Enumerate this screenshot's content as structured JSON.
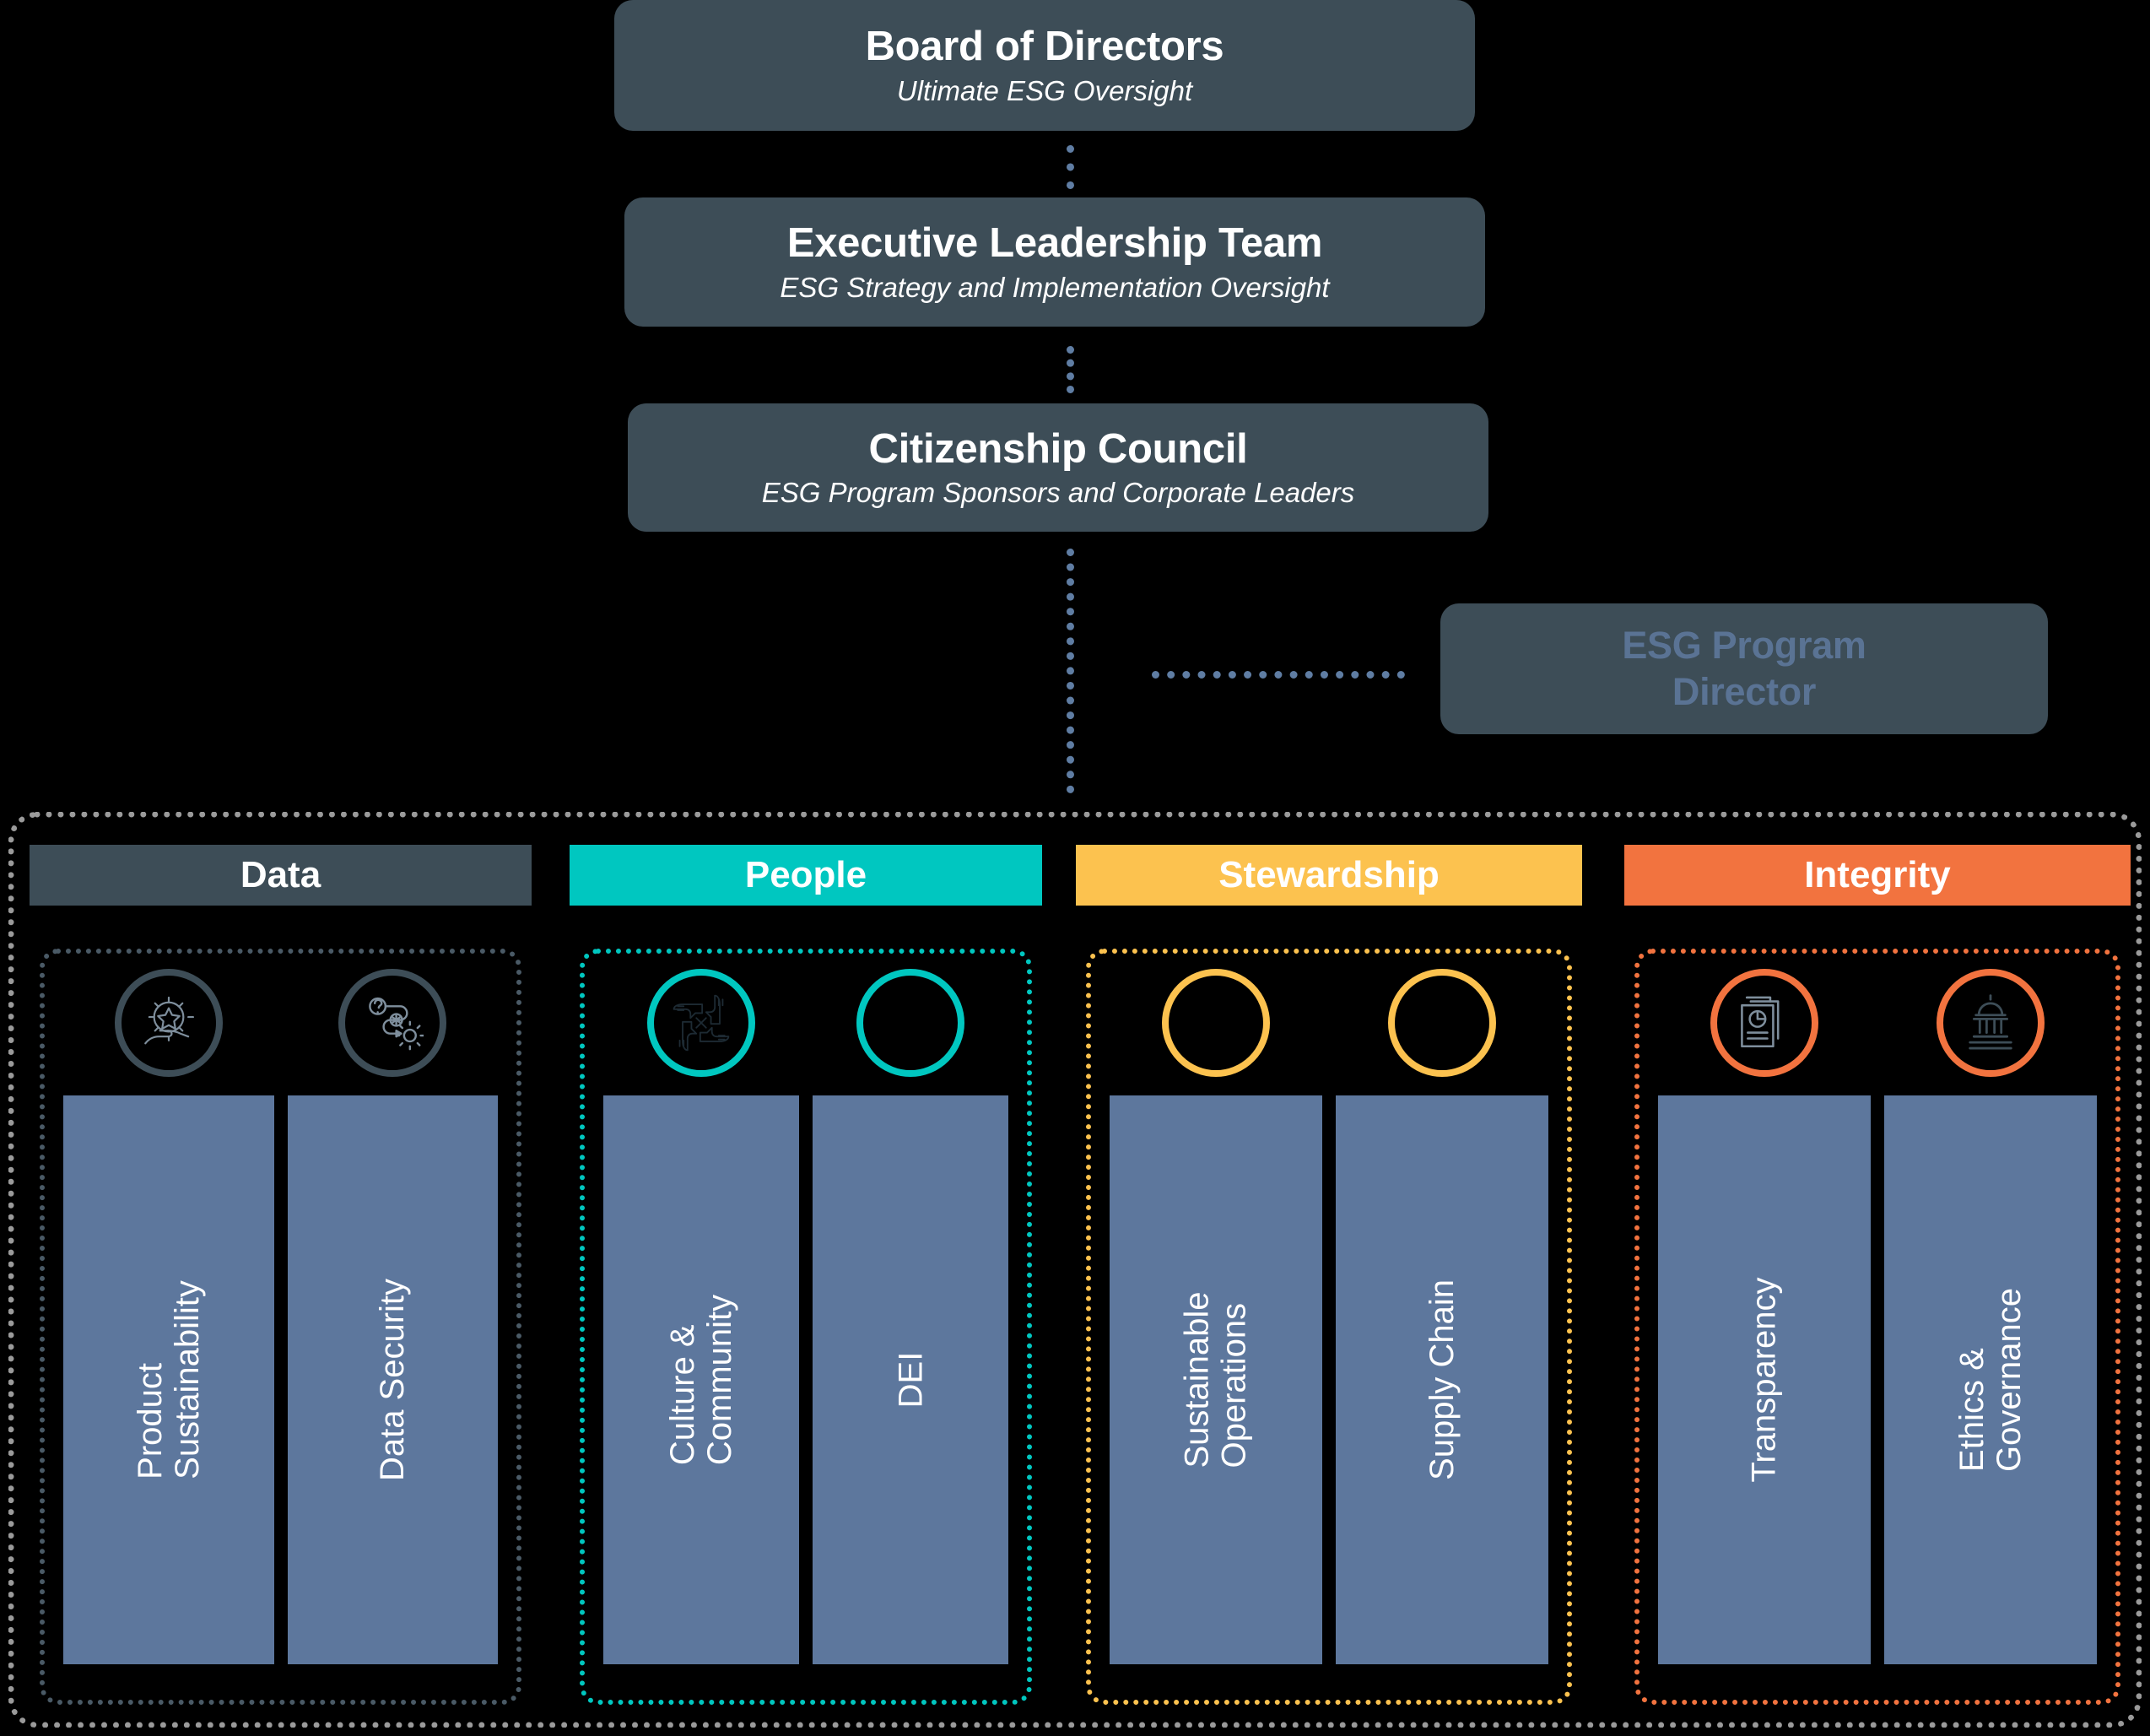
{
  "governance": {
    "boxes": [
      {
        "title": "Board of Directors",
        "subtitle": "Ultimate ESG Oversight"
      },
      {
        "title": "Executive Leadership Team",
        "subtitle": "ESG Strategy and Implementation Oversight"
      },
      {
        "title": "Citizenship Council",
        "subtitle": "ESG Program Sponsors and Corporate Leaders"
      }
    ],
    "director": {
      "title": "ESG Program\nDirector"
    }
  },
  "colors": {
    "box_bg": "#3d4d57",
    "connector": "#5f7da3",
    "director_text": "#5a7394",
    "topic_bar": "#5d779d",
    "outer_border": "#9a9a9a",
    "data": "#3d4d57",
    "people": "#00c7c0",
    "stewardship": "#fcc24f",
    "integrity": "#f2733f"
  },
  "pillars": [
    {
      "name": "Data",
      "accent": "#3d4d57",
      "topics": [
        {
          "label": "Product\nSustainability",
          "icon": "hand-star-icon"
        },
        {
          "label": "Data Security",
          "icon": "process-path-icon"
        }
      ]
    },
    {
      "name": "People",
      "accent": "#00c7c0",
      "topics": [
        {
          "label": "Culture &\nCommunity",
          "icon": "interlocking-hands-icon"
        },
        {
          "label": "DEI",
          "icon": "none"
        }
      ]
    },
    {
      "name": "Stewardship",
      "accent": "#fcc24f",
      "topics": [
        {
          "label": "Sustainable\nOperations",
          "icon": "none"
        },
        {
          "label": "Supply Chain",
          "icon": "none"
        }
      ]
    },
    {
      "name": "Integrity",
      "accent": "#f2733f",
      "topics": [
        {
          "label": "Transparency",
          "icon": "report-document-icon"
        },
        {
          "label": "Ethics &\nGovernance",
          "icon": "government-building-icon"
        }
      ]
    }
  ]
}
